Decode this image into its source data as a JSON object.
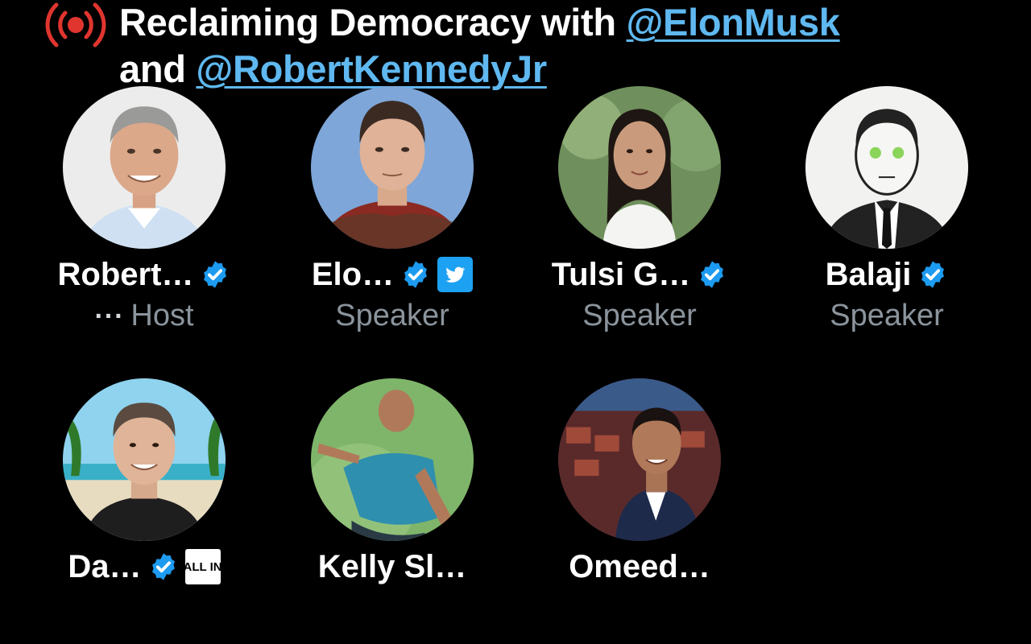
{
  "space": {
    "title_prefix": "Reclaiming Democracy with ",
    "mention_1": "@ElonMusk",
    "title_mid": "and ",
    "mention_2": "@RobertKennedyJr",
    "live_icon": "live-broadcast-icon",
    "accent_color": "#e0352f",
    "link_color": "#5fb8f0"
  },
  "speakers": [
    {
      "name": "Robert…",
      "role": "Host",
      "more": "···",
      "verified": true
    },
    {
      "name": "Elo…",
      "role": "Speaker",
      "verified": true,
      "affiliate": "twitter-logo-icon"
    },
    {
      "name": "Tulsi G…",
      "role": "Speaker",
      "verified": true
    },
    {
      "name": "Balaji",
      "role": "Speaker",
      "verified": true
    },
    {
      "name": "Da…",
      "verified": true,
      "affiliate_text": "ALL IN"
    },
    {
      "name": "Kelly Sl…"
    },
    {
      "name": "Omeed…"
    }
  ],
  "colors": {
    "verified": "#1d9bf0",
    "role_text": "#8b949c",
    "background": "#000000"
  }
}
